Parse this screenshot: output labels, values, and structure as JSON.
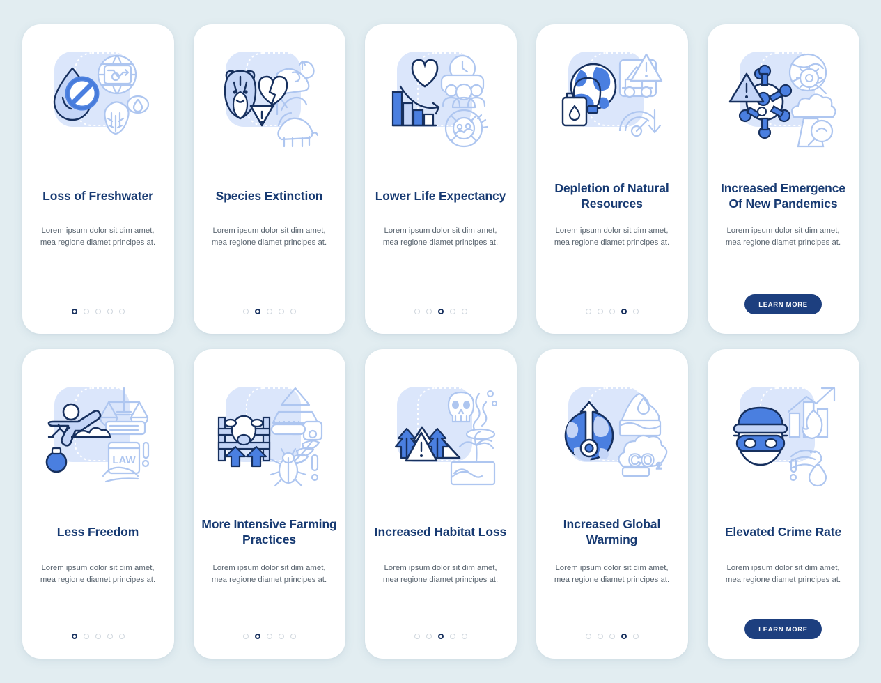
{
  "page": {
    "background_color": "#e2edf1",
    "title_color": "#173a72",
    "body_color": "#59646f",
    "accent_color": "#1d3f7f",
    "illustration_blue": "#4a7fe0",
    "illustration_light": "#c4d5f7",
    "card_background": "#ffffff"
  },
  "common": {
    "body_text": "Lorem ipsum dolor sit dim amet, mea regione diamet principes at.",
    "learn_more_label": "LEARN MORE",
    "dot_count": 5
  },
  "rows": [
    {
      "name": "top-row",
      "screens": [
        {
          "id": "loss-of-freshwater",
          "title": "Loss of Freshwater",
          "body": "Lorem ipsum dolor sit dim amet, mea regione diamet principes at.",
          "illustration": "water-drop-prohibited-globe-icon",
          "active_dot": 1,
          "footer": "dots"
        },
        {
          "id": "species-extinction",
          "title": "Species Extinction",
          "body": "Lorem ipsum dolor sit dim amet, mea regione diamet principes at.",
          "illustration": "lion-broken-heart-rhino-icon",
          "active_dot": 2,
          "footer": "dots"
        },
        {
          "id": "lower-life-expectancy",
          "title": "Lower Life Expectancy",
          "body": "Lorem ipsum dolor sit dim amet, mea regione diamet principes at.",
          "illustration": "declining-bar-chart-heart-people-icon",
          "active_dot": 3,
          "footer": "dots"
        },
        {
          "id": "depletion-of-natural-resources",
          "title": "Depletion of Natural Resources",
          "body": "Lorem ipsum dolor sit dim amet, mea regione diamet principes at.",
          "illustration": "globe-oil-can-excavator-gauge-icon",
          "active_dot": 4,
          "footer": "dots"
        },
        {
          "id": "increased-emergence-of-new-pandemics",
          "title": "Increased Emergence Of New Pandemics",
          "body": "Lorem ipsum dolor sit dim amet, mea regione diamet principes at.",
          "illustration": "virus-warning-globe-factory-icon",
          "active_dot": 5,
          "footer": "learn-more"
        }
      ]
    },
    {
      "name": "bottom-row",
      "screens": [
        {
          "id": "less-freedom",
          "title": "Less Freedom",
          "body": "Lorem ipsum dolor sit dim amet, mea regione diamet principes at.",
          "illustration": "person-ball-chain-scales-law-book-icon",
          "illustration_label": "LAW",
          "active_dot": 1,
          "footer": "dots"
        },
        {
          "id": "more-intensive-farming-practices",
          "title": "More Intensive Farming Practices",
          "body": "Lorem ipsum dolor sit dim amet, mea regione diamet principes at.",
          "illustration": "cow-fence-chainsaw-tree-beetle-icon",
          "active_dot": 2,
          "footer": "dots"
        },
        {
          "id": "increased-habitat-loss",
          "title": "Increased Habitat Loss",
          "body": "Lorem ipsum dolor sit dim amet, mea regione diamet principes at.",
          "illustration": "mountains-trees-skull-coral-palm-icon",
          "active_dot": 3,
          "footer": "dots"
        },
        {
          "id": "increased-global-warming",
          "title": "Increased Global Warming",
          "body": "Lorem ipsum dolor sit dim amet, mea regione diamet principes at.",
          "illustration": "globe-thermometer-iceberg-co2-cloud-icon",
          "illustration_label": "CO2",
          "active_dot": 4,
          "footer": "dots"
        },
        {
          "id": "elevated-crime-rate",
          "title": "Elevated Crime Rate",
          "body": "Lorem ipsum dolor sit dim amet, mea regione diamet principes at.",
          "illustration": "masked-thief-rising-chart-fire-icon",
          "active_dot": 5,
          "footer": "learn-more"
        }
      ]
    }
  ]
}
